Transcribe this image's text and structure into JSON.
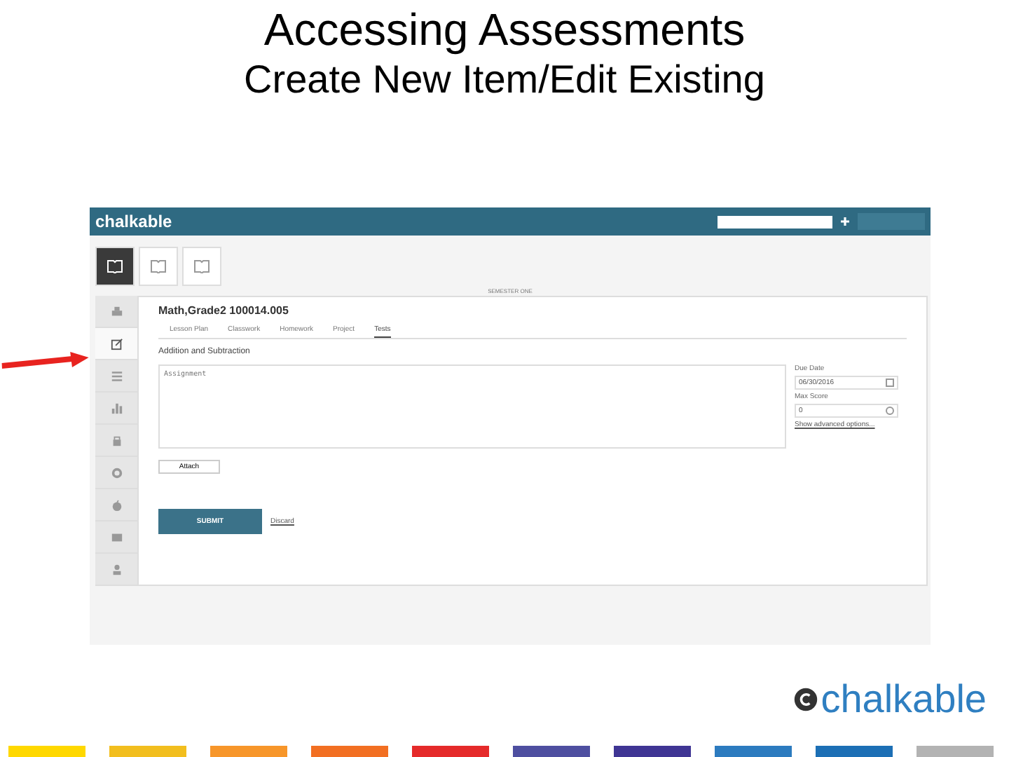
{
  "slide": {
    "title": "Accessing Assessments",
    "subtitle": "Create New Item/Edit Existing"
  },
  "app": {
    "brand": "chalkable",
    "class_tiles": [
      {
        "selected": true
      },
      {
        "selected": false
      },
      {
        "selected": false
      }
    ],
    "term": "SEMESTER ONE",
    "sidebar": [
      {
        "selected": false
      },
      {
        "selected": true
      },
      {
        "selected": false
      },
      {
        "selected": false
      },
      {
        "selected": false
      },
      {
        "selected": false
      },
      {
        "selected": false
      },
      {
        "selected": false
      },
      {
        "selected": false
      }
    ],
    "class_name": "Math,Grade2 100014.005",
    "tabs": [
      {
        "label": "Lesson Plan",
        "selected": false
      },
      {
        "label": "Classwork",
        "selected": false
      },
      {
        "label": "Homework",
        "selected": false
      },
      {
        "label": "Project",
        "selected": false
      },
      {
        "label": "Tests",
        "selected": true
      }
    ],
    "item_title": "Addition and Subtraction",
    "description": {
      "placeholder": "Assignment"
    },
    "due_date": {
      "label": "Due Date",
      "value": "06/30/2016"
    },
    "max_score": {
      "label": "Max Score",
      "value": "0"
    },
    "advanced_link": "Show advanced options...",
    "attach_button": "Attach",
    "submit_button": "SUBMIT",
    "discard_link": "Discard"
  },
  "footer": {
    "logo": "chalkable",
    "color_bars": [
      {
        "color": "#ffd800"
      },
      {
        "color": "#f2be1e"
      },
      {
        "color": "#f7962a"
      },
      {
        "color": "#f26f22"
      },
      {
        "color": "#e52a2a"
      },
      {
        "color": "#4e4fa0"
      },
      {
        "color": "#3f3594"
      },
      {
        "color": "#2c7bbf"
      },
      {
        "color": "#1c6fb5"
      },
      {
        "color": "#b3b3b3"
      }
    ]
  }
}
